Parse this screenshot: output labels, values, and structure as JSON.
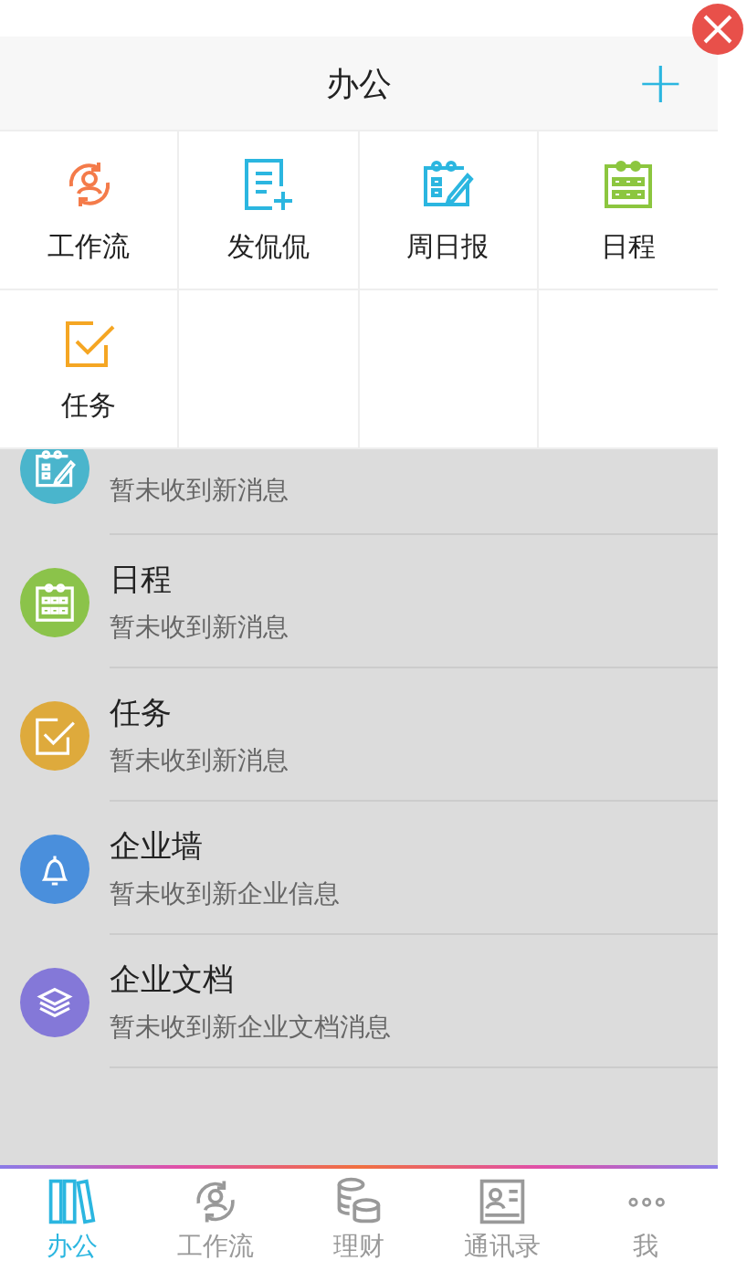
{
  "header": {
    "title": "办公",
    "add_symbol": "+"
  },
  "apps": [
    {
      "label": "工作流",
      "kind": "workflow"
    },
    {
      "label": "发侃侃",
      "kind": "post"
    },
    {
      "label": "周日报",
      "kind": "report"
    },
    {
      "label": "日程",
      "kind": "calendar"
    },
    {
      "label": "任务",
      "kind": "task"
    }
  ],
  "messages": [
    {
      "kind": "report",
      "subtitle": "暂未收到新消息"
    },
    {
      "kind": "calendar",
      "title": "日程",
      "subtitle": "暂未收到新消息"
    },
    {
      "kind": "task",
      "title": "任务",
      "subtitle": "暂未收到新消息"
    },
    {
      "kind": "bell",
      "title": "企业墙",
      "subtitle": "暂未收到新企业信息"
    },
    {
      "kind": "layers",
      "title": "企业文档",
      "subtitle": "暂未收到新企业文档消息"
    }
  ],
  "tab_bar": [
    {
      "label": "办公",
      "kind": "books",
      "selected": true
    },
    {
      "label": "工作流",
      "kind": "workflow",
      "selected": false
    },
    {
      "label": "理财",
      "kind": "coins",
      "selected": false
    },
    {
      "label": "通讯录",
      "kind": "contact",
      "selected": false
    },
    {
      "label": "我",
      "kind": "more",
      "selected": false
    }
  ]
}
